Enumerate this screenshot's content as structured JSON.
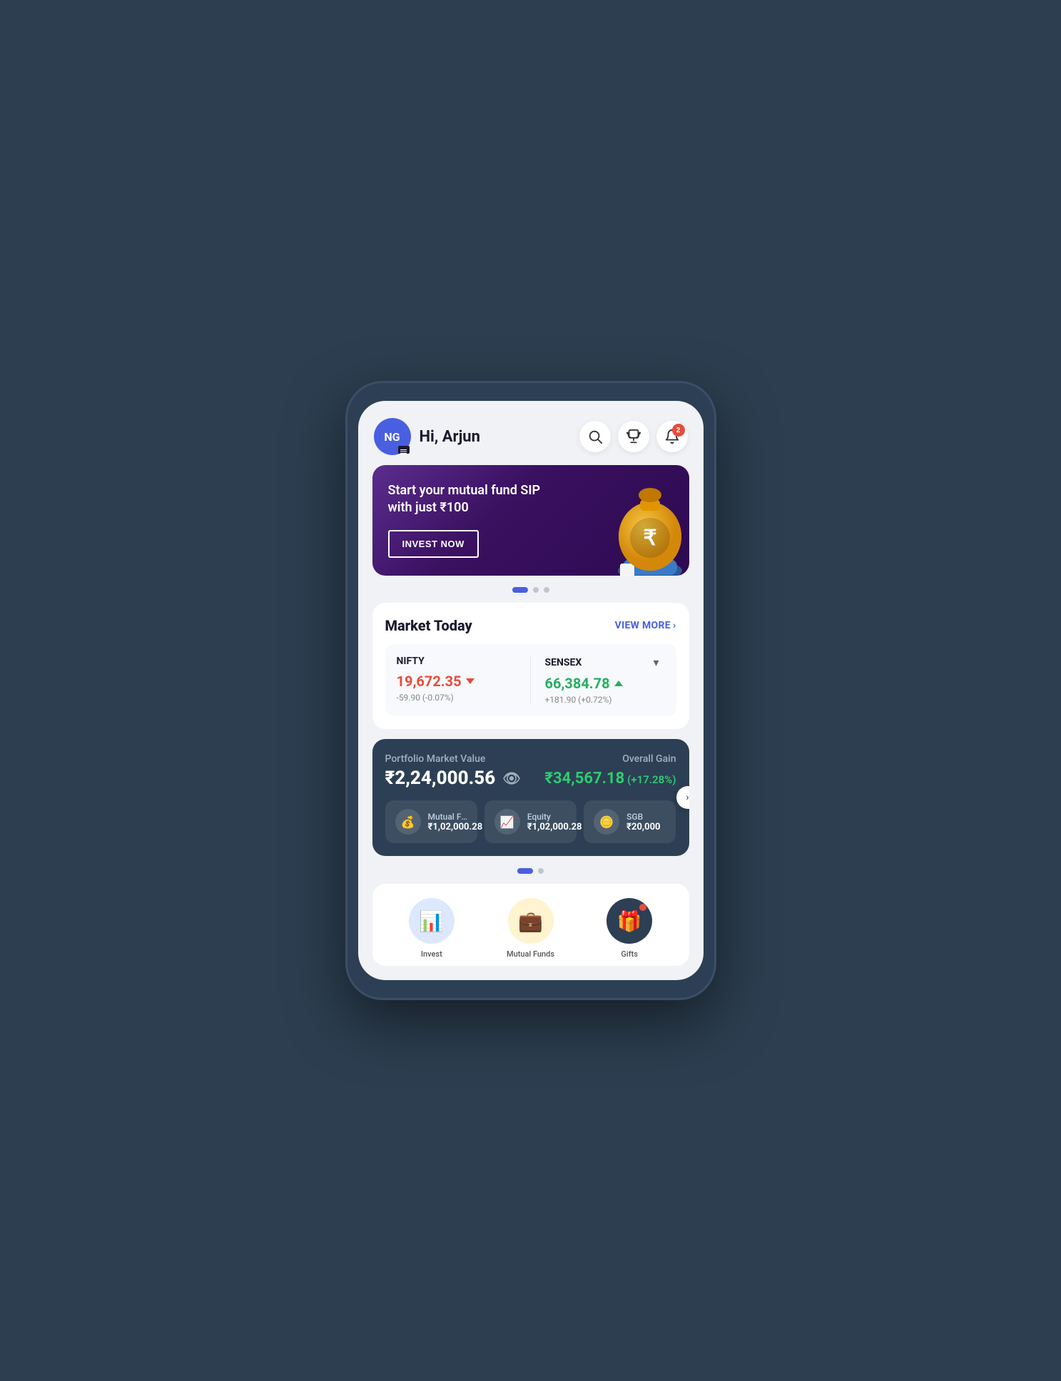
{
  "header": {
    "avatar_initials": "NG",
    "greeting": "Hi, Arjun",
    "notification_count": "2"
  },
  "banner": {
    "title": "Start your mutual fund SIP with just ₹100",
    "invest_button": "INVEST NOW",
    "carousel_dots": [
      "active",
      "inactive",
      "inactive"
    ]
  },
  "market": {
    "section_title": "Market Today",
    "view_more_label": "VIEW MORE",
    "indices": [
      {
        "name": "NIFTY",
        "value": "19,672.35",
        "direction": "down",
        "change": "-59.90 (-0.07%)"
      },
      {
        "name": "SENSEX",
        "value": "66,384.78",
        "direction": "up",
        "change": "+181.90 (+0.72%)"
      }
    ]
  },
  "portfolio": {
    "label": "Portfolio Market Value",
    "main_value": "₹2,24,000.56",
    "gain_label": "Overall Gain",
    "gain_amount": "₹34,567.18",
    "gain_percent": "(+17.28%)",
    "sub_cards": [
      {
        "name": "Mutual Funds",
        "value": "₹1,02,000.28",
        "icon": "💰"
      },
      {
        "name": "Equity",
        "value": "₹1,02,000.28",
        "icon": "📈"
      },
      {
        "name": "SGB",
        "value": "₹20,000",
        "icon": "🪙"
      }
    ],
    "carousel_dots": [
      "active",
      "inactive"
    ]
  },
  "bottom_icons": [
    {
      "label": "Invest",
      "bg": "blue-light",
      "icon": "📊"
    },
    {
      "label": "Mutual Funds",
      "bg": "yellow",
      "icon": "💼"
    },
    {
      "label": "Gifts",
      "bg": "dark",
      "icon": "🎁",
      "has_badge": true
    }
  ],
  "icons": {
    "search": "search-icon",
    "trophy": "trophy-icon",
    "bell": "bell-icon"
  }
}
